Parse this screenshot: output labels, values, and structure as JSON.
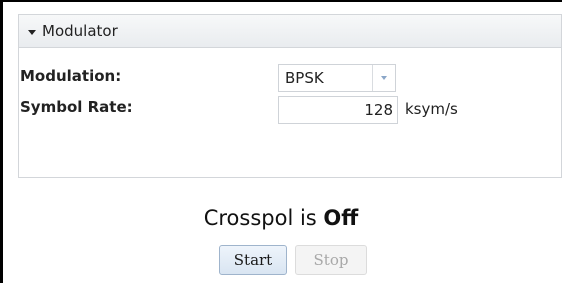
{
  "panel": {
    "title": "Modulator"
  },
  "fields": {
    "modulation": {
      "label": "Modulation:",
      "value": "BPSK"
    },
    "symbol_rate": {
      "label": "Symbol Rate:",
      "value": "128",
      "unit": "ksym/s"
    }
  },
  "status": {
    "prefix": "Crosspol is",
    "state": "Off"
  },
  "buttons": {
    "start": "Start",
    "stop": "Stop"
  }
}
